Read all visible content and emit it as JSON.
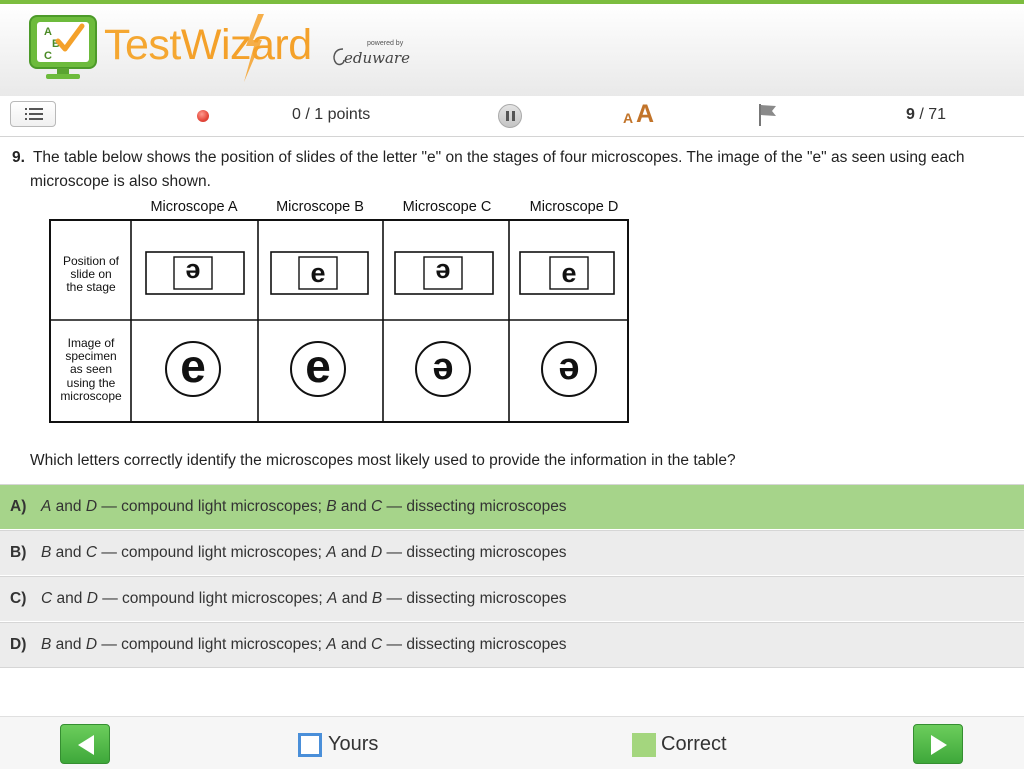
{
  "logo": {
    "name_part1": "Test",
    "name_part2": "Wizard",
    "icon_letters": [
      "A",
      "B",
      "C"
    ],
    "powered_by": "powered by",
    "brand": "eduware"
  },
  "toolbar": {
    "menu_icon": "list-icon",
    "points": "0 / 1 points",
    "font_small": "A",
    "font_large": "A",
    "flag_icon": "flag-icon",
    "page_current": "9",
    "page_total": " / 71"
  },
  "question": {
    "number": "9.",
    "text": "The table below shows the position of slides of the letter \"e\" on the stages of four microscopes. The image of the \"e\" as seen using each microscope is also shown.",
    "prompt": "Which letters correctly identify the microscopes most likely used to provide the information in the table?"
  },
  "table": {
    "columns": [
      "Microscope A",
      "Microscope B",
      "Microscope C",
      "Microscope D"
    ],
    "row_labels": [
      [
        "Position of",
        "slide on",
        "the stage"
      ],
      [
        "Image of",
        "specimen",
        "as seen",
        "using the",
        "microscope"
      ]
    ],
    "slide_row": [
      {
        "letter": "e",
        "inverted": true
      },
      {
        "letter": "e",
        "inverted": false
      },
      {
        "letter": "e",
        "inverted": true
      },
      {
        "letter": "e",
        "inverted": false
      }
    ],
    "image_row": [
      {
        "letter": "e",
        "inverted": false
      },
      {
        "letter": "e",
        "inverted": false
      },
      {
        "letter": "e",
        "inverted": true
      },
      {
        "letter": "e",
        "inverted": true
      }
    ]
  },
  "answers": [
    {
      "label": "A)",
      "selected": true,
      "segments": [
        {
          "t": "A",
          "i": true
        },
        {
          "t": " and "
        },
        {
          "t": "D",
          "i": true
        },
        {
          "t": " — compound light microscopes; "
        },
        {
          "t": "B",
          "i": true
        },
        {
          "t": " and "
        },
        {
          "t": "C",
          "i": true
        },
        {
          "t": " — dissecting microscopes"
        }
      ]
    },
    {
      "label": "B)",
      "selected": false,
      "segments": [
        {
          "t": "B",
          "i": true
        },
        {
          "t": " and "
        },
        {
          "t": "C",
          "i": true
        },
        {
          "t": " — compound light microscopes; "
        },
        {
          "t": "A",
          "i": true
        },
        {
          "t": " and "
        },
        {
          "t": "D",
          "i": true
        },
        {
          "t": " — dissecting microscopes"
        }
      ]
    },
    {
      "label": "C)",
      "selected": false,
      "segments": [
        {
          "t": "C",
          "i": true
        },
        {
          "t": " and "
        },
        {
          "t": "D",
          "i": true
        },
        {
          "t": " — compound light microscopes; "
        },
        {
          "t": "A",
          "i": true
        },
        {
          "t": " and "
        },
        {
          "t": "B",
          "i": true
        },
        {
          "t": " — dissecting microscopes"
        }
      ]
    },
    {
      "label": "D)",
      "selected": false,
      "segments": [
        {
          "t": "B",
          "i": true
        },
        {
          "t": " and "
        },
        {
          "t": "D",
          "i": true
        },
        {
          "t": " — compound light microscopes; "
        },
        {
          "t": "A",
          "i": true
        },
        {
          "t": " and "
        },
        {
          "t": "C",
          "i": true
        },
        {
          "t": " — dissecting microscopes"
        }
      ]
    }
  ],
  "footer": {
    "yours": "Yours",
    "correct": "Correct"
  },
  "colors": {
    "accent_orange": "#f5a731",
    "selected_answer": "#a6d48a",
    "answer_bg": "#ececec",
    "yours_outline": "#4a8fd9",
    "correct_fill": "#a4d67e",
    "nav_green": "#4cb846"
  }
}
